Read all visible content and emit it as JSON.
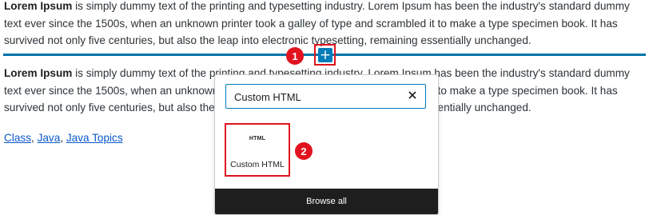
{
  "paragraph1": {
    "bold": "Lorem Ipsum",
    "text": " is simply dummy text of the printing and typesetting industry. Lorem Ipsum has been the industry's standard dummy text ever since the 1500s, when an unknown printer took a galley of type and scrambled it to make a type specimen book. It has survived not only five centuries, but also the leap into electronic typesetting, remaining essentially unchanged."
  },
  "paragraph2": {
    "bold": "Lorem Ipsum",
    "text": " is simply dummy text of the printing and typesetting industry. Lorem Ipsum has been the industry's standard dummy text ever since the 1500s, when an unknown printer took a galley of type and scrambled it to make a type specimen book. It has survived not only five centuries, but also the leap into electronic typesetting, remaining essentially unchanged."
  },
  "inserter": {
    "plus_label": "+"
  },
  "annotations": {
    "badge1": "1",
    "badge2": "2",
    "highlight_color": "#e0131f"
  },
  "links": [
    {
      "label": "Class",
      "sep": ", "
    },
    {
      "label": "Java",
      "sep": ", "
    },
    {
      "label": "Java Topics",
      "sep": ""
    }
  ],
  "popover": {
    "search_value": "Custom HTML",
    "block": {
      "icon_text": "HTML",
      "label": "Custom HTML"
    },
    "browse_all": "Browse all"
  },
  "colors": {
    "accent": "#007cba",
    "link": "#0a58ca",
    "browse_bg": "#1e1e1e"
  }
}
